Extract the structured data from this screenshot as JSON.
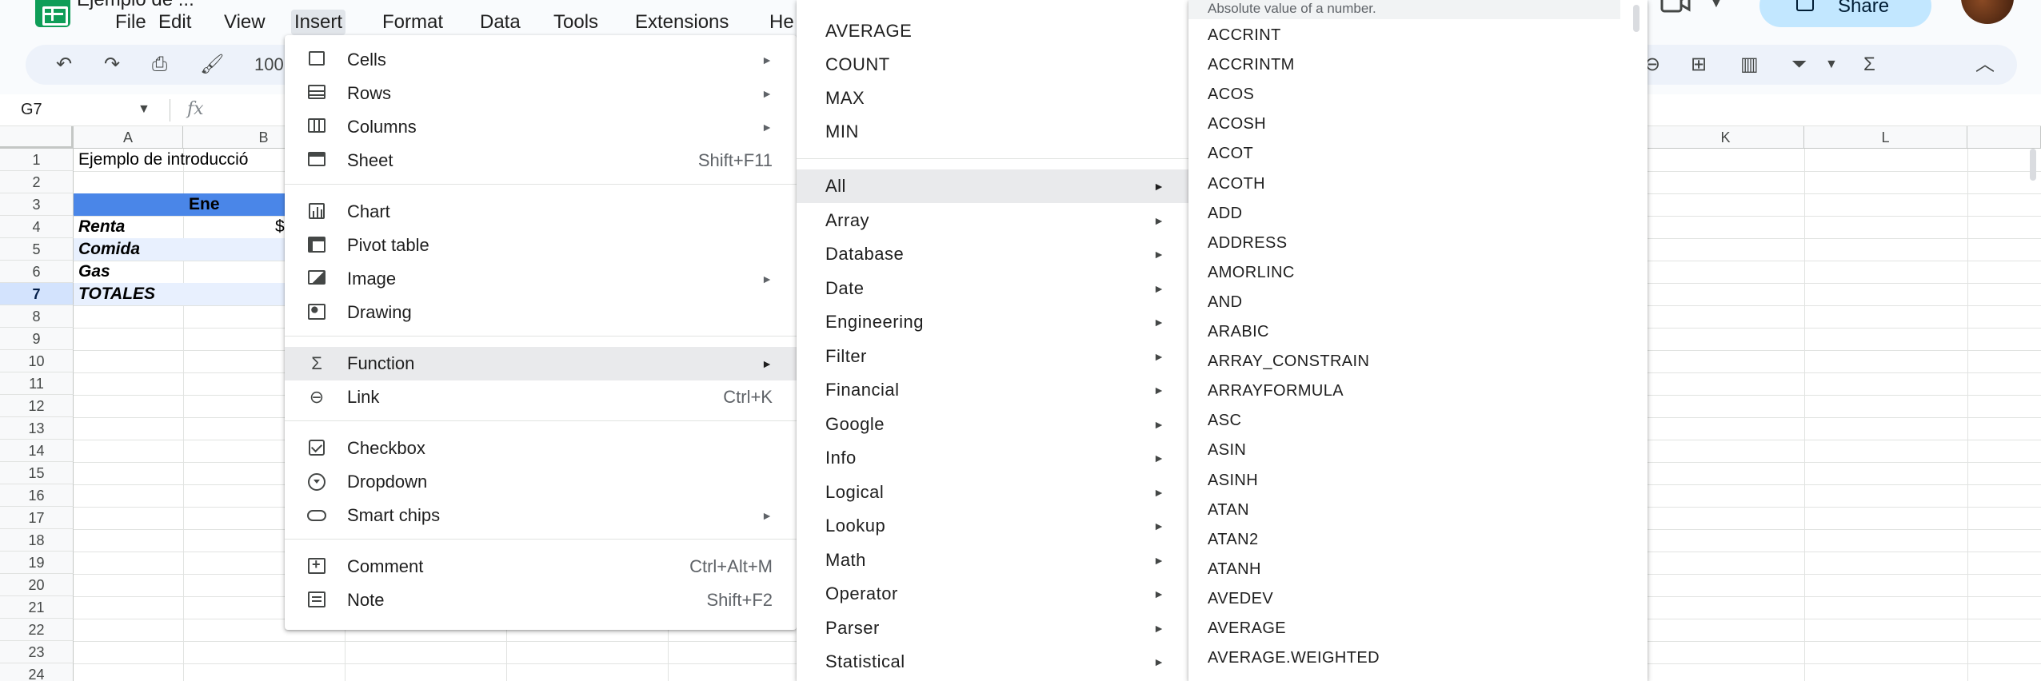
{
  "menubar": {
    "title_fragment": "Ejemplo de ...",
    "items": [
      "File",
      "Edit",
      "View",
      "Insert",
      "Format",
      "Data",
      "Tools",
      "Extensions",
      "He"
    ],
    "share_label": "Share"
  },
  "toolbar": {
    "zoom": "100"
  },
  "formula_bar": {
    "cell_ref": "G7",
    "fx": "fx"
  },
  "grid": {
    "columns": [
      "A",
      "B",
      "K",
      "L"
    ],
    "rows": [
      "1",
      "2",
      "3",
      "4",
      "5",
      "6",
      "7",
      "8",
      "9",
      "10",
      "11",
      "12",
      "13",
      "14",
      "15",
      "16",
      "17",
      "18",
      "19",
      "20",
      "21",
      "22",
      "23",
      "24"
    ],
    "cells": {
      "a1": "Ejemplo de introducció",
      "b3": "Ene",
      "a4": "Renta",
      "b4": "$",
      "a5": "Comida",
      "a6": "Gas",
      "a7": "TOTALES"
    }
  },
  "insert_menu": {
    "items": [
      {
        "label": "Cells",
        "icon": "cells-icon"
      },
      {
        "label": "Rows",
        "icon": "rows-icon"
      },
      {
        "label": "Columns",
        "icon": "columns-icon"
      },
      {
        "label": "Sheet",
        "shortcut": "Shift+F11",
        "icon": "sheet-icon"
      },
      {
        "label": "Chart",
        "icon": "chart-icon"
      },
      {
        "label": "Pivot table",
        "icon": "pivot-table-icon"
      },
      {
        "label": "Image",
        "icon": "image-icon"
      },
      {
        "label": "Drawing",
        "icon": "drawing-icon"
      },
      {
        "label": "Function",
        "icon": "sigma-icon"
      },
      {
        "label": "Link",
        "shortcut": "Ctrl+K",
        "icon": "link-icon"
      },
      {
        "label": "Checkbox",
        "icon": "checkbox-icon"
      },
      {
        "label": "Dropdown",
        "icon": "dropdown-icon"
      },
      {
        "label": "Smart chips",
        "icon": "smart-chips-icon"
      },
      {
        "label": "Comment",
        "shortcut": "Ctrl+Alt+M",
        "icon": "comment-icon"
      },
      {
        "label": "Note",
        "shortcut": "Shift+F2",
        "icon": "note-icon"
      }
    ]
  },
  "function_menu": {
    "quick": [
      "AVERAGE",
      "COUNT",
      "MAX",
      "MIN"
    ],
    "categories": [
      "All",
      "Array",
      "Database",
      "Date",
      "Engineering",
      "Filter",
      "Financial",
      "Google",
      "Info",
      "Logical",
      "Lookup",
      "Math",
      "Operator",
      "Parser",
      "Statistical"
    ]
  },
  "all_menu": {
    "tooltip": "Absolute value of a number.",
    "items": [
      "ACCRINT",
      "ACCRINTM",
      "ACOS",
      "ACOSH",
      "ACOT",
      "ACOTH",
      "ADD",
      "ADDRESS",
      "AMORLINC",
      "AND",
      "ARABIC",
      "ARRAY_CONSTRAIN",
      "ARRAYFORMULA",
      "ASC",
      "ASIN",
      "ASINH",
      "ATAN",
      "ATAN2",
      "ATANH",
      "AVEDEV",
      "AVERAGE",
      "AVERAGE.WEIGHTED"
    ]
  },
  "colors": {
    "accent": "#4a86e8",
    "selection": "#d3e3fd",
    "share": "#c2e7ff",
    "logo": "#0f9d58"
  }
}
